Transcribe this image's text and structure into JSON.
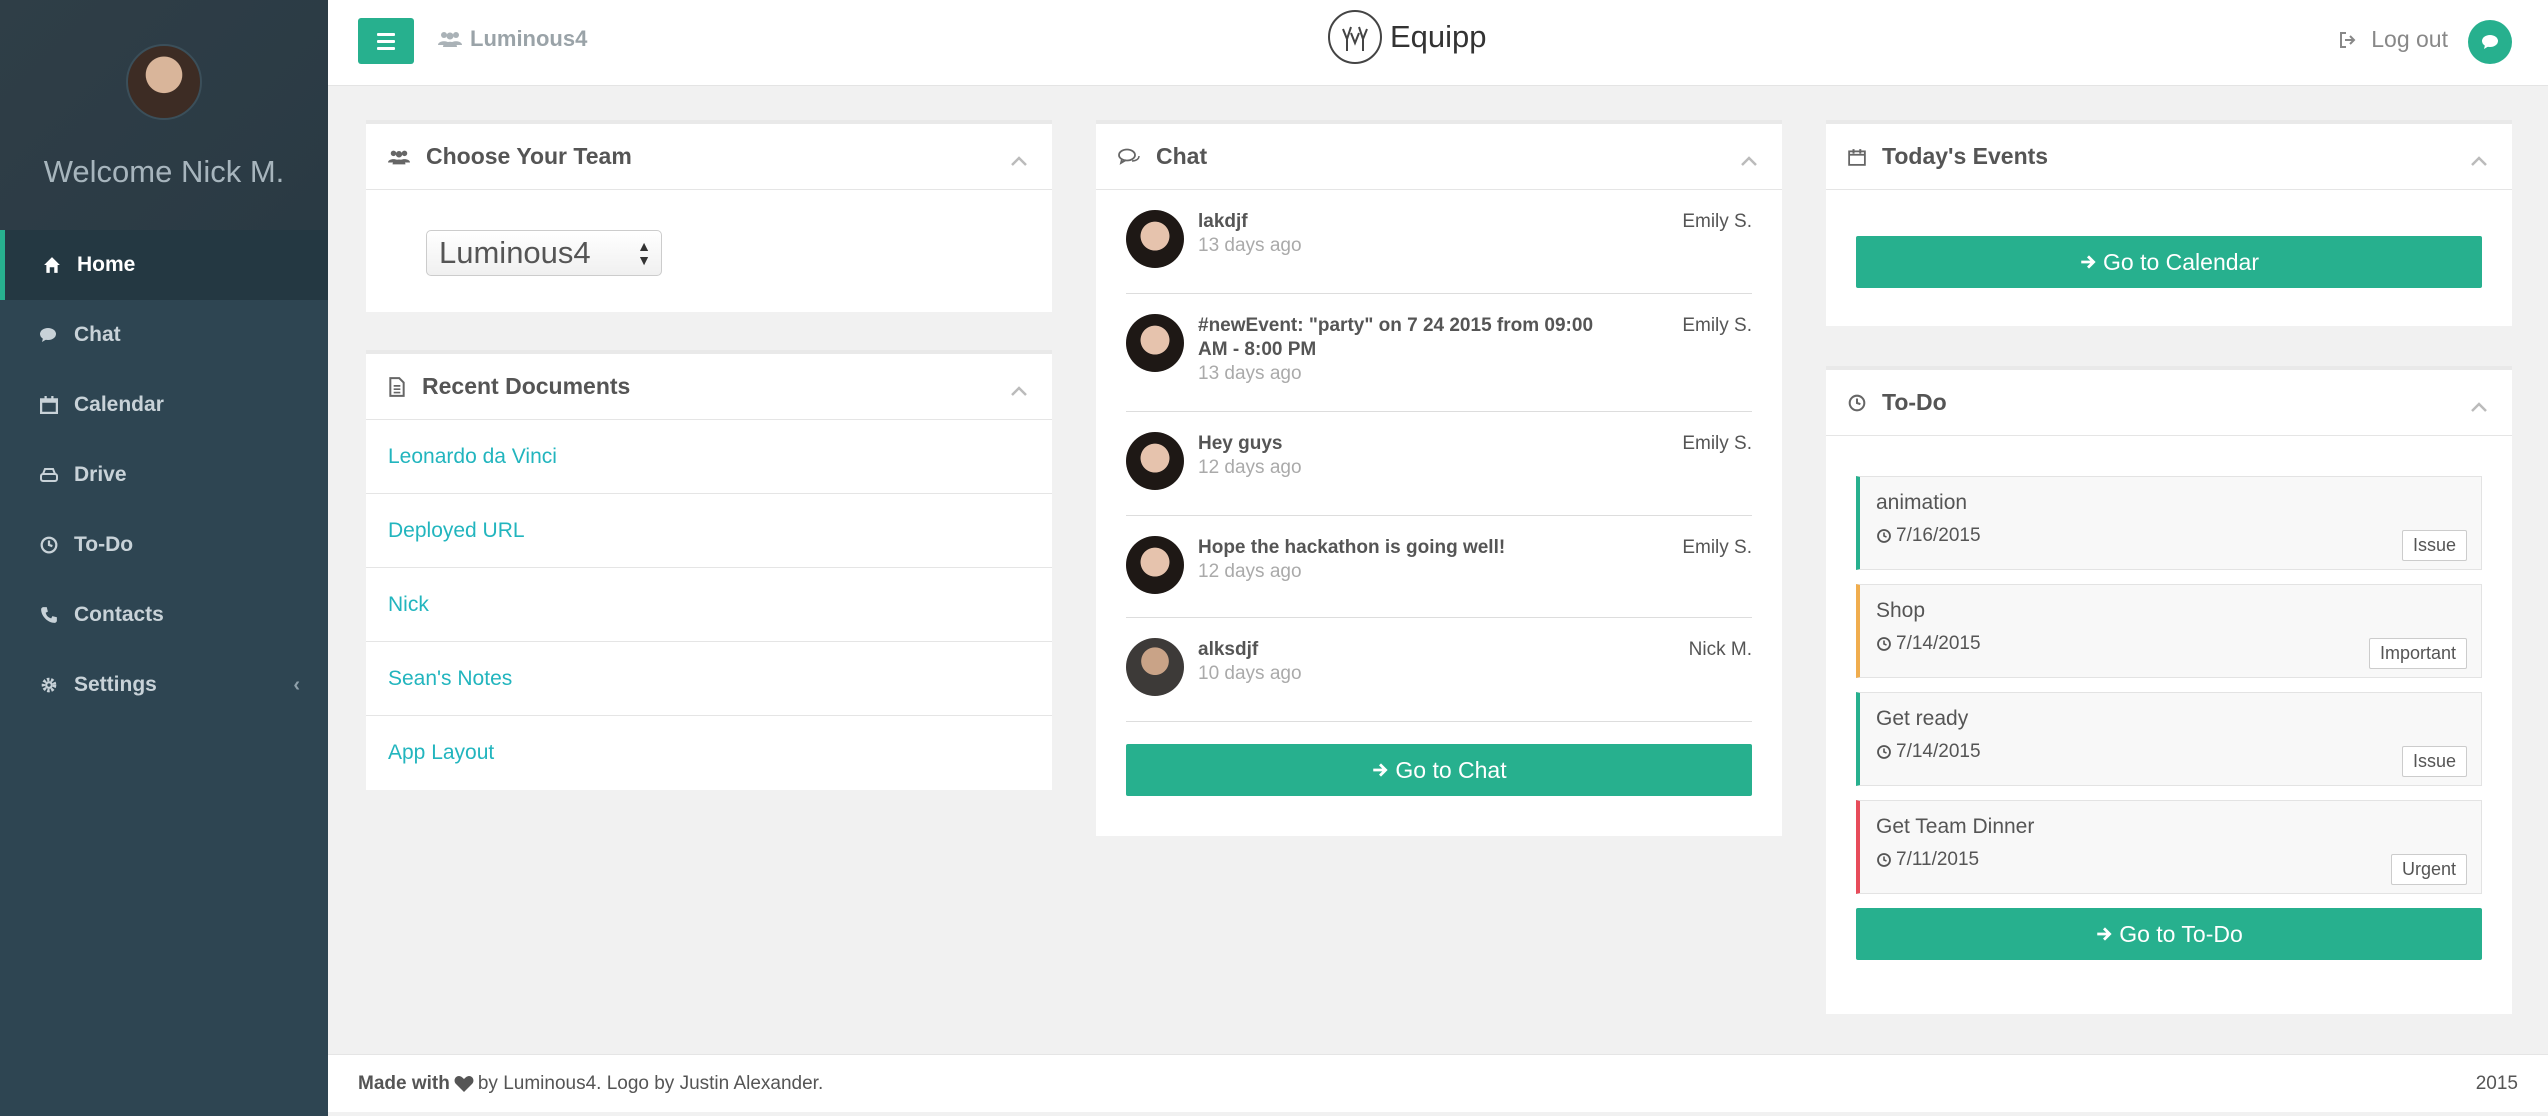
{
  "sidebar": {
    "welcome": "Welcome Nick M.",
    "items": [
      {
        "label": "Home",
        "icon": "home-icon"
      },
      {
        "label": "Chat",
        "icon": "chat-icon"
      },
      {
        "label": "Calendar",
        "icon": "calendar-icon"
      },
      {
        "label": "Drive",
        "icon": "drive-icon"
      },
      {
        "label": "To-Do",
        "icon": "clock-icon"
      },
      {
        "label": "Contacts",
        "icon": "phone-icon"
      },
      {
        "label": "Settings",
        "icon": "gear-icon"
      }
    ],
    "settings_chevron": "‹"
  },
  "topbar": {
    "team_name": "Luminous4",
    "brand": "Equipp",
    "logout": "Log out"
  },
  "team_panel": {
    "title": "Choose Your Team",
    "selected": "Luminous4"
  },
  "docs_panel": {
    "title": "Recent Documents",
    "items": [
      "Leonardo da Vinci",
      "Deployed URL",
      "Nick",
      "Sean's Notes",
      "App Layout"
    ]
  },
  "chat_panel": {
    "title": "Chat",
    "messages": [
      {
        "text": "lakdjf",
        "time": "13 days ago",
        "author": "Emily S."
      },
      {
        "text": "#newEvent: \"party\" on 7 24 2015 from 09:00 AM - 8:00 PM",
        "time": "13 days ago",
        "author": "Emily S."
      },
      {
        "text": "Hey guys",
        "time": "12 days ago",
        "author": "Emily S."
      },
      {
        "text": "Hope the hackathon is going well!",
        "time": "12 days ago",
        "author": "Emily S."
      },
      {
        "text": "alksdjf",
        "time": "10 days ago",
        "author": "Nick M."
      }
    ],
    "button": "Go to Chat"
  },
  "events_panel": {
    "title": "Today's Events",
    "button": "Go to Calendar"
  },
  "todo_panel": {
    "title": "To-Do",
    "items": [
      {
        "title": "animation",
        "date": "7/16/2015",
        "tag": "Issue",
        "color": "#27b08e"
      },
      {
        "title": "Shop",
        "date": "7/14/2015",
        "tag": "Important",
        "color": "#f0ad4e"
      },
      {
        "title": "Get ready",
        "date": "7/14/2015",
        "tag": "Issue",
        "color": "#27b08e"
      },
      {
        "title": "Get Team Dinner",
        "date": "7/11/2015",
        "tag": "Urgent",
        "color": "#e74c5a"
      }
    ],
    "button": "Go to To-Do"
  },
  "footer": {
    "made_with": "Made with",
    "by": "by Luminous4. Logo by Justin Alexander.",
    "year": "2015"
  },
  "colors": {
    "accent": "#27b08e",
    "sidebar": "#2e4552",
    "link": "#22b5be"
  }
}
